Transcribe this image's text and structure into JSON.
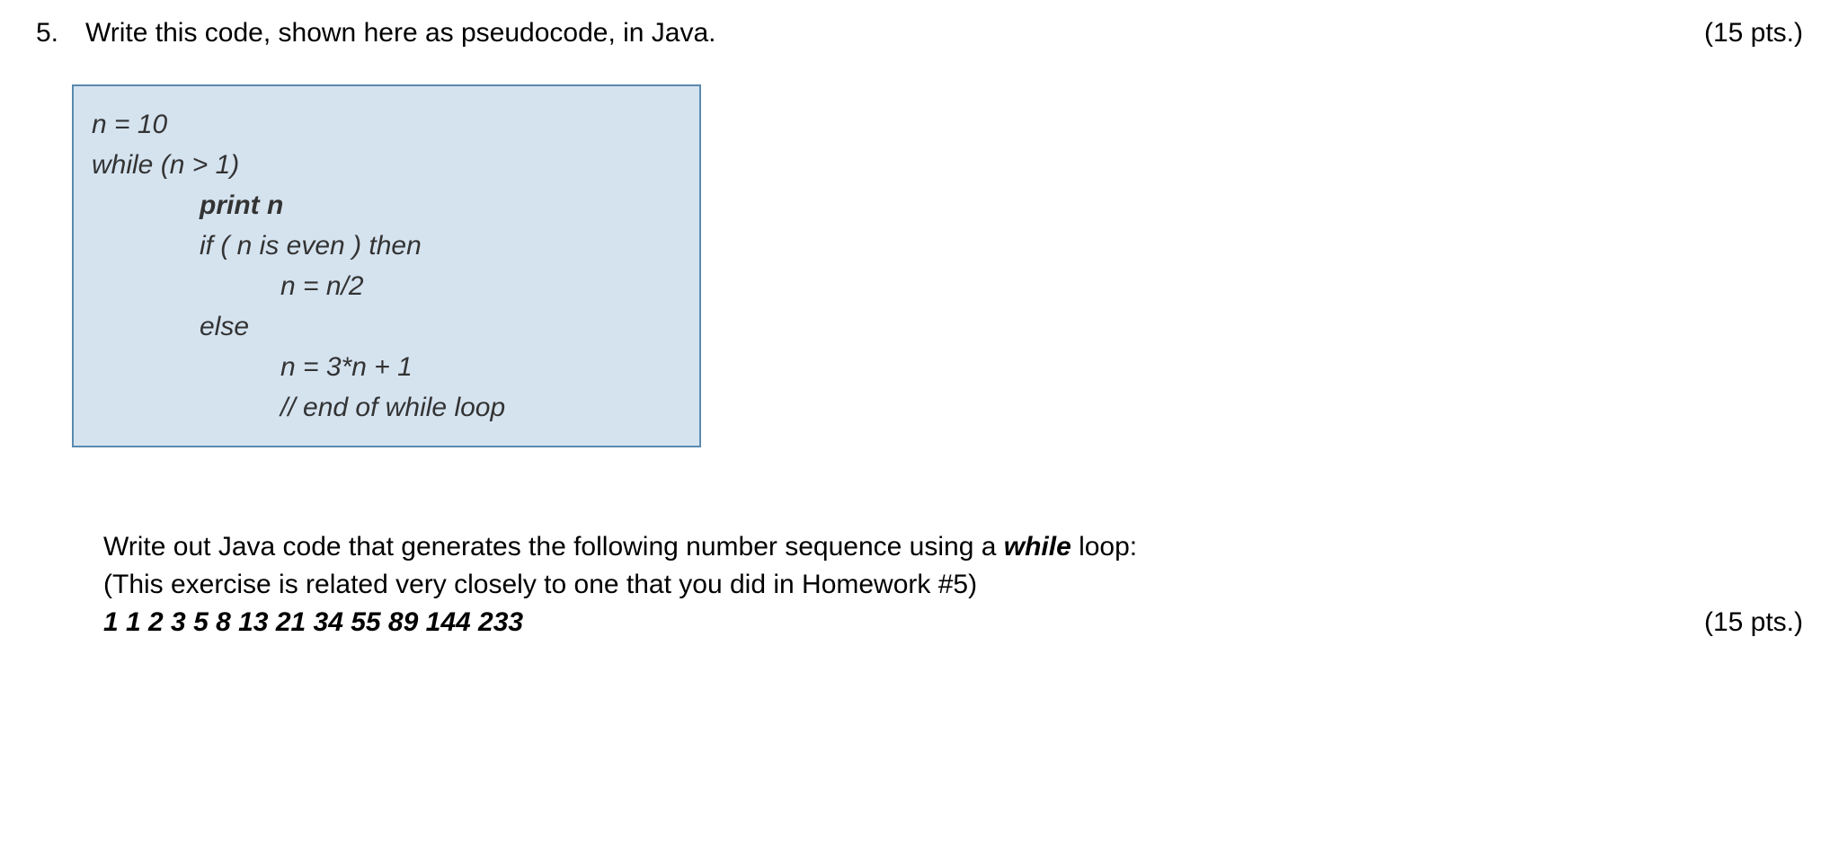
{
  "question": {
    "number": "5.",
    "text": "Write this code, shown here as pseudocode, in Java.",
    "points": "(15 pts.)"
  },
  "code": {
    "line1": "n = 10",
    "line2": "while (n > 1)",
    "line3": "print n",
    "line4": "if ( n is even ) then",
    "line5": "n = n/2",
    "line6": "else",
    "line7": "n = 3*n + 1",
    "line8": "// end of while loop"
  },
  "second": {
    "line1_pre": "Write out Java code that generates the following number sequence using a ",
    "line1_bold": "while",
    "line1_post": " loop:",
    "line2": "(This exercise is related very closely to one that you did in Homework #5)",
    "sequence": "1 1 2 3 5 8 13 21 34 55 89 144 233",
    "points": "(15 pts.)"
  }
}
